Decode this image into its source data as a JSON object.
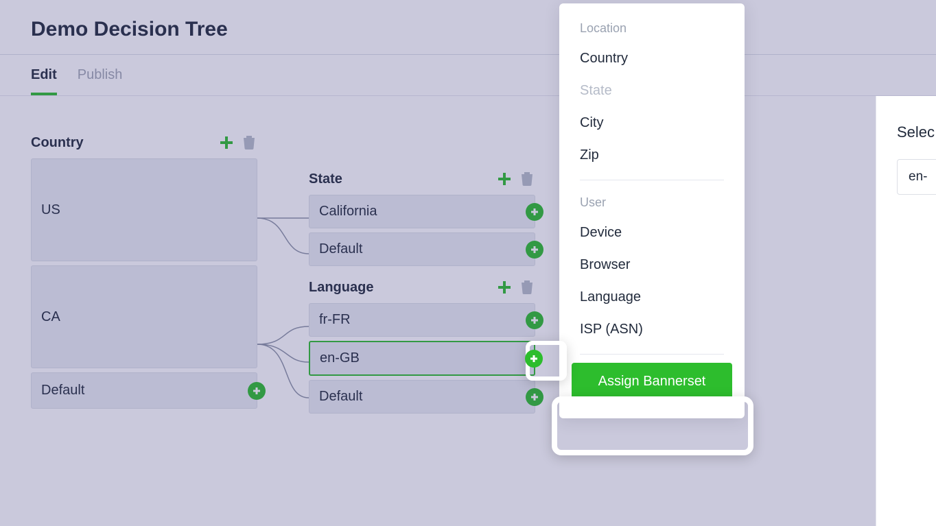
{
  "header": {
    "title": "Demo Decision Tree"
  },
  "tabs": [
    {
      "label": "Edit",
      "active": true
    },
    {
      "label": "Publish",
      "active": false
    }
  ],
  "tree": {
    "country": {
      "title": "Country",
      "items": [
        "US",
        "CA",
        "Default"
      ]
    },
    "state": {
      "title": "State",
      "items": [
        "California",
        "Default"
      ]
    },
    "language": {
      "title": "Language",
      "items": [
        "fr-FR",
        "en-GB",
        "Default"
      ],
      "selected": "en-GB"
    }
  },
  "dropdown": {
    "sections": [
      {
        "label": "Location",
        "items": [
          {
            "label": "Country",
            "disabled": false
          },
          {
            "label": "State",
            "disabled": true
          },
          {
            "label": "City",
            "disabled": false
          },
          {
            "label": "Zip",
            "disabled": false
          }
        ]
      },
      {
        "label": "User",
        "items": [
          {
            "label": "Device",
            "disabled": false
          },
          {
            "label": "Browser",
            "disabled": false
          },
          {
            "label": "Language",
            "disabled": false
          },
          {
            "label": "ISP (ASN)",
            "disabled": false
          }
        ]
      }
    ],
    "assign_label": "Assign Bannerset"
  },
  "right_panel": {
    "label": "Selec",
    "input_value": "en-"
  }
}
